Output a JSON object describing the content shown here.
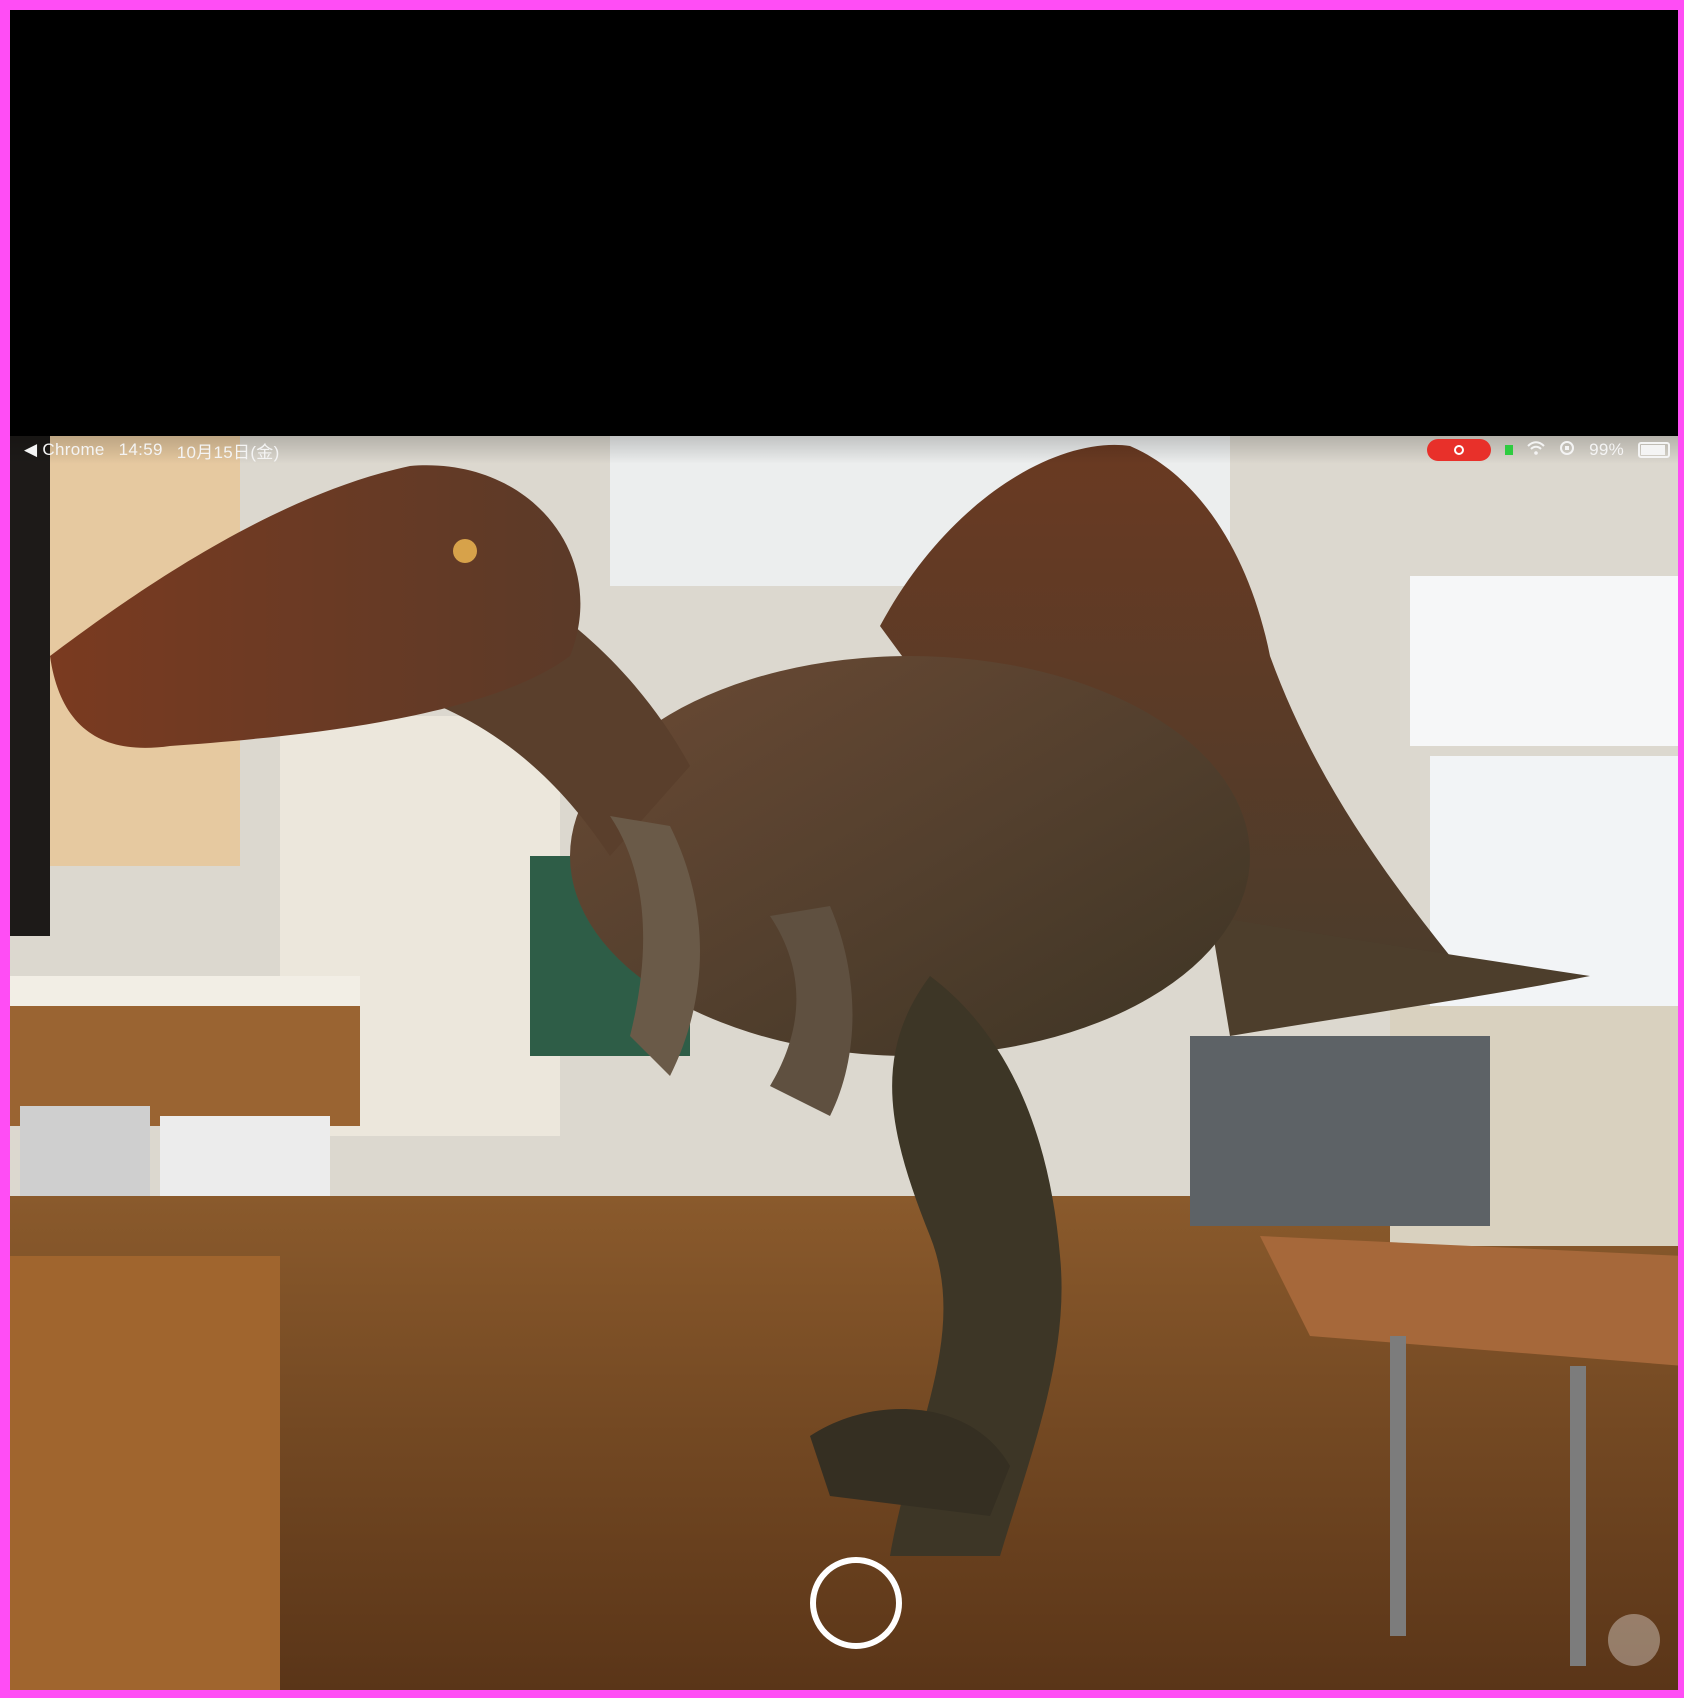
{
  "status_bar": {
    "back_app": "◀ Chrome",
    "time": "14:59",
    "date": "10月15日(金)",
    "battery_percent": "99%",
    "battery_level": 0.99,
    "recording": true
  },
  "colors": {
    "frame_border": "#ff4df5",
    "recording_pill": "#e8302a"
  },
  "icons": {
    "back": "chevron-left-icon",
    "recording": "record-icon",
    "wifi": "wifi-icon",
    "orientation_lock": "orientation-lock-icon",
    "battery": "battery-icon"
  }
}
